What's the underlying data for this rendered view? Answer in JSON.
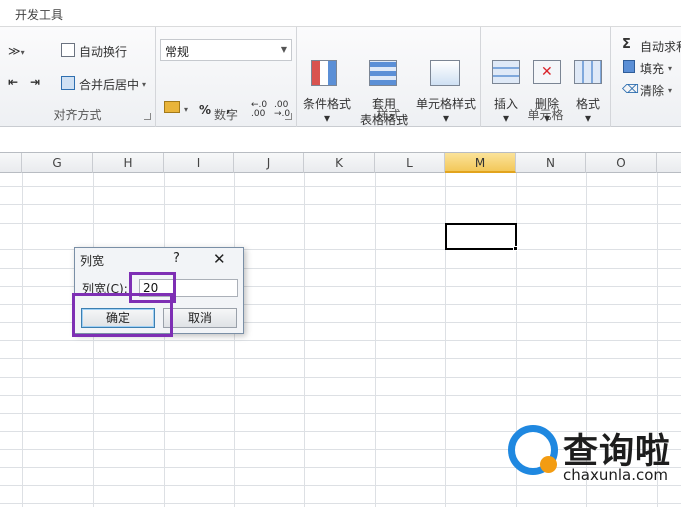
{
  "tabs": {
    "active": "开发工具"
  },
  "ribbon": {
    "alignment": {
      "wrap_text": "自动换行",
      "merge_center": "合并后居中",
      "group_label": "对齐方式"
    },
    "number": {
      "format_value": "常规",
      "percent": "%",
      "comma": ",",
      "inc_decimal": "+.0\n.00",
      "group_label": "数字"
    },
    "styles": {
      "conditional_format": "条件格式",
      "table_format_line1": "套用",
      "table_format_line2": "表格格式",
      "cell_styles": "单元格样式",
      "group_label": "样式"
    },
    "cells": {
      "insert": "插入",
      "delete": "删除",
      "format": "格式",
      "group_label": "单元格"
    },
    "editing": {
      "autosum": "自动求和",
      "sigma": "Σ",
      "fill": "填充",
      "clear": "清除"
    }
  },
  "columns": [
    "G",
    "H",
    "I",
    "J",
    "K",
    "L",
    "M",
    "N",
    "O"
  ],
  "selected_column": "M",
  "dialog": {
    "title": "列宽",
    "help": "?",
    "close": "✕",
    "label": "列宽(C):",
    "value": "20",
    "ok": "确定",
    "cancel": "取消"
  },
  "watermark": {
    "name": "查询啦",
    "url": "chaxunla.com"
  },
  "colors": {
    "highlight": "#7e2fb4",
    "selected_header": "#f3c85a",
    "logo_blue": "#1f88e0",
    "logo_orange": "#f39c12"
  }
}
